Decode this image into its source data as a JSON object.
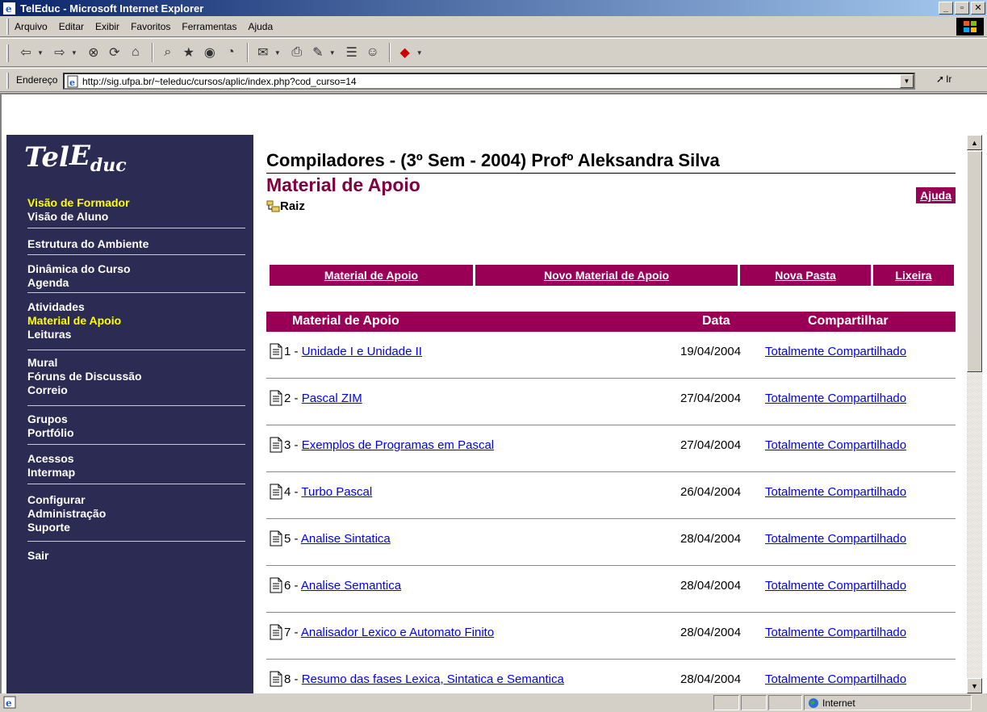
{
  "window": {
    "title": "TelEduc - Microsoft Internet Explorer"
  },
  "menu": [
    "Arquivo",
    "Editar",
    "Exibir",
    "Favoritos",
    "Ferramentas",
    "Ajuda"
  ],
  "address": {
    "label": "Endereço",
    "url": "http://sig.ufpa.br/~teleduc/cursos/aplic/index.php?cod_curso=14",
    "go_label": "Ir"
  },
  "sidebar": {
    "logo": {
      "tel": "Tel",
      "e": "E",
      "duc": "duc"
    },
    "groups": [
      [
        {
          "label": "Visão de Formador",
          "active": true
        },
        {
          "label": "Visão de Aluno",
          "active": false
        }
      ],
      [
        {
          "label": "Estrutura do Ambiente",
          "active": false
        }
      ],
      [
        {
          "label": "Dinâmica do Curso",
          "active": false
        },
        {
          "label": "Agenda",
          "active": false
        }
      ],
      [
        {
          "label": "Atividades",
          "active": false
        },
        {
          "label": "Material de Apoio",
          "active": true
        },
        {
          "label": "Leituras",
          "active": false
        }
      ],
      [
        {
          "label": "Mural",
          "active": false
        },
        {
          "label": "Fóruns de Discussão",
          "active": false
        },
        {
          "label": "Correio",
          "active": false
        }
      ],
      [
        {
          "label": "Grupos",
          "active": false
        },
        {
          "label": "Portfólio",
          "active": false
        }
      ],
      [
        {
          "label": "Acessos",
          "active": false
        },
        {
          "label": "Intermap",
          "active": false
        }
      ],
      [
        {
          "label": "Configurar",
          "active": false
        },
        {
          "label": "Administração",
          "active": false
        },
        {
          "label": "Suporte",
          "active": false
        }
      ],
      [
        {
          "label": "Sair",
          "active": false
        }
      ]
    ]
  },
  "main": {
    "course_title": "Compiladores - (3º Sem - 2004) Profº Aleksandra Silva",
    "section_title": "Material de Apoio",
    "help_label": "Ajuda",
    "breadcrumb_root": "Raiz",
    "nav_buttons": [
      "Material de Apoio",
      "Novo Material de Apoio",
      "Nova Pasta",
      "Lixeira"
    ],
    "table_headers": {
      "title": "Material de Apoio",
      "date": "Data",
      "share": "Compartilhar"
    },
    "rows": [
      {
        "num": "1",
        "title": "Unidade I e Unidade II",
        "date": "19/04/2004",
        "share": "Totalmente Compartilhado"
      },
      {
        "num": "2",
        "title": "Pascal ZIM",
        "date": "27/04/2004",
        "share": "Totalmente Compartilhado"
      },
      {
        "num": "3",
        "title": "Exemplos de Programas em Pascal",
        "date": "27/04/2004",
        "share": "Totalmente Compartilhado"
      },
      {
        "num": "4",
        "title": "Turbo Pascal",
        "date": "26/04/2004",
        "share": "Totalmente Compartilhado"
      },
      {
        "num": "5",
        "title": "Analise Sintatica",
        "date": "28/04/2004",
        "share": "Totalmente Compartilhado"
      },
      {
        "num": "6",
        "title": "Analise Semantica",
        "date": "28/04/2004",
        "share": "Totalmente Compartilhado"
      },
      {
        "num": "7",
        "title": "Analisador Lexico e Automato Finito",
        "date": "28/04/2004",
        "share": "Totalmente Compartilhado"
      },
      {
        "num": "8",
        "title": "Resumo das fases Lexica, Sintatica e Semantica",
        "date": "28/04/2004",
        "share": "Totalmente Compartilhado"
      }
    ]
  },
  "status": {
    "zone": "Internet"
  },
  "colors": {
    "sidebar_bg": "#2b2b54",
    "accent": "#990055",
    "active_nav": "#ffff00",
    "link": "#0000ee",
    "title_bar": "#0a246a"
  }
}
